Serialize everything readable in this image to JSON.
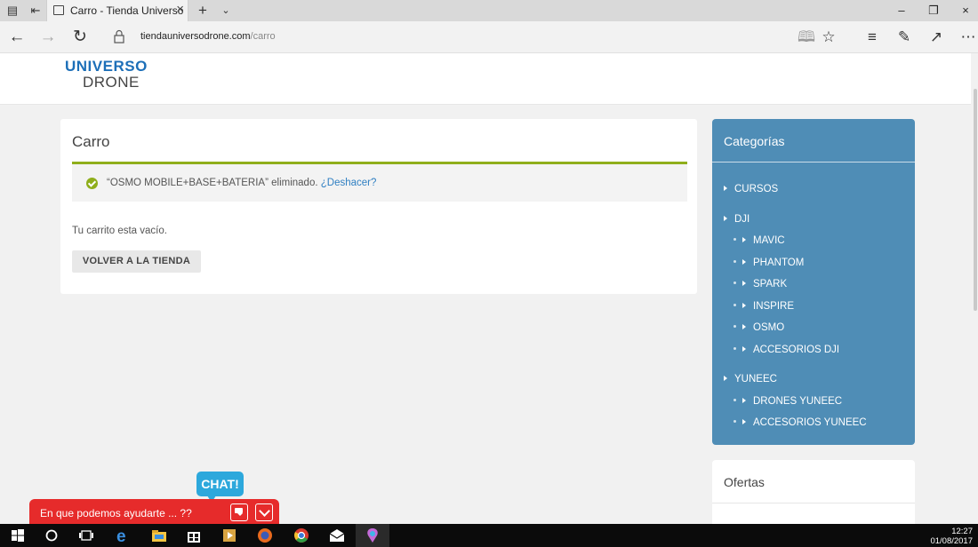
{
  "browser": {
    "tab_title": "Carro - Tienda Universo",
    "url_host": "tiendauniversodrone.com",
    "url_path": "/carro"
  },
  "site": {
    "logo_top": "UNIVERSO",
    "logo_bottom": "DRONE"
  },
  "cart": {
    "title": "Carro",
    "notice_item": "“OSMO MOBILE+BASE+BATERIA” eliminado.",
    "undo_link": "¿Deshacer?",
    "empty_message": "Tu carrito esta vacío.",
    "return_button": "VOLVER A LA TIENDA"
  },
  "sidebar": {
    "categories_title": "Categorías",
    "categories": [
      {
        "label": "CURSOS",
        "level": 0
      },
      {
        "label": "DJI",
        "level": 0
      },
      {
        "label": "MAVIC",
        "level": 1
      },
      {
        "label": "PHANTOM",
        "level": 1
      },
      {
        "label": "SPARK",
        "level": 1
      },
      {
        "label": "INSPIRE",
        "level": 1
      },
      {
        "label": "OSMO",
        "level": 1
      },
      {
        "label": "ACCESORIOS DJI",
        "level": 1
      },
      {
        "label": "YUNEEC",
        "level": 0
      },
      {
        "label": "DRONES YUNEEC",
        "level": 1
      },
      {
        "label": "ACCESORIOS YUNEEC",
        "level": 1
      }
    ],
    "offers_title": "Ofertas"
  },
  "chat": {
    "badge": "CHAT!",
    "prompt": "En que podemos ayudarte ... ??"
  },
  "taskbar": {
    "time": "12:27",
    "date": "01/08/2017"
  },
  "colors": {
    "accent_green": "#8fae1b",
    "sidebar_blue": "#4f8db6",
    "link_blue": "#2f7fc2",
    "chat_red": "#e62b2b",
    "chat_badge": "#2da8dc"
  }
}
